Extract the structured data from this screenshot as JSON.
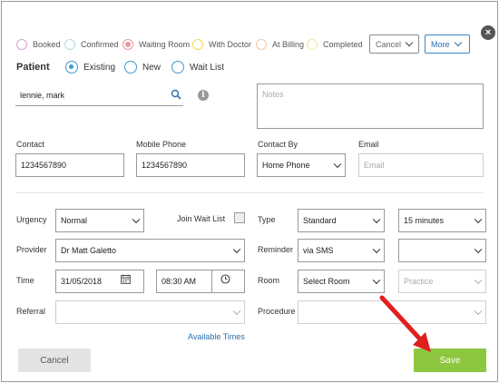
{
  "status_legend": [
    {
      "label": "Booked",
      "color": "#d7a1d7"
    },
    {
      "label": "Confirmed",
      "color": "#b5d8e8"
    },
    {
      "label": "Waiting Room",
      "color": "#e89a9a"
    },
    {
      "label": "With Doctor",
      "color": "#f3d84a"
    },
    {
      "label": "At Billing",
      "color": "#f5c7a5"
    },
    {
      "label": "Completed",
      "color": "#f2e7a6"
    }
  ],
  "header": {
    "cancel_label": "Cancel",
    "more_label": "More",
    "close_icon": "close-icon"
  },
  "patient": {
    "label": "Patient",
    "options": [
      "Existing",
      "New",
      "Wait List"
    ],
    "selected": "Existing",
    "search_value": "lennie, mark",
    "notes_placeholder": "Notes"
  },
  "contact": {
    "contact_label": "Contact",
    "contact_value": "1234567890",
    "mobile_label": "Mobile Phone",
    "mobile_value": "1234567890",
    "contact_by_label": "Contact By",
    "contact_by_value": "Home Phone",
    "email_label": "Email",
    "email_placeholder": "Email"
  },
  "appointment": {
    "urgency_label": "Urgency",
    "urgency_value": "Normal",
    "join_wait_list_label": "Join Wait List",
    "type_label": "Type",
    "type_value": "Standard",
    "duration_value": "15 minutes",
    "provider_label": "Provider",
    "provider_value": "Dr Matt Galetto",
    "reminder_label": "Reminder",
    "reminder_value": "via SMS",
    "reminder_extra_value": "",
    "time_label": "Time",
    "date_value": "31/05/2018",
    "time_value": "08:30 AM",
    "room_label": "Room",
    "room_value": "Select Room",
    "practice_placeholder": "Practice",
    "referral_label": "Referral",
    "referral_value": "",
    "procedure_label": "Procedure",
    "procedure_value": "",
    "available_times_label": "Available Times"
  },
  "footer": {
    "cancel_label": "Cancel",
    "save_label": "Save"
  },
  "colors": {
    "accent": "#3a9bcf",
    "save": "#8dc63f",
    "annotation_arrow": "#e02020"
  }
}
